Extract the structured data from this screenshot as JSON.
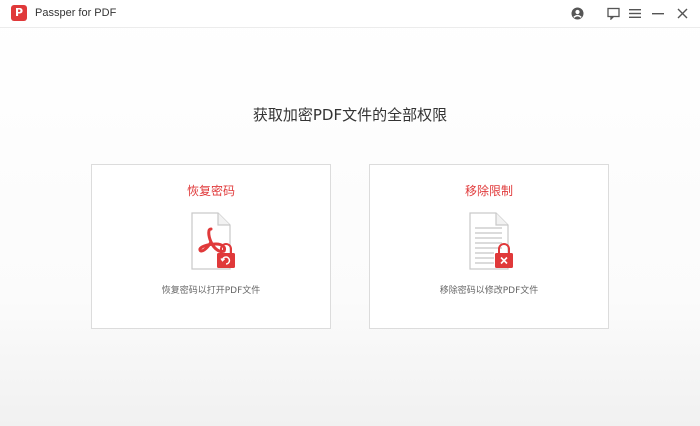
{
  "app": {
    "title": "Passper for PDF",
    "logo_letter": "P"
  },
  "titlebar": {
    "buttons": [
      "account-icon",
      "feedback-icon",
      "menu-icon",
      "minimize-icon",
      "close-icon"
    ]
  },
  "main": {
    "heading": "获取加密PDF文件的全部权限",
    "cards": [
      {
        "title": "恢复密码",
        "desc": "恢复密码以打开PDF文件",
        "icon": "pdf-unlock-icon"
      },
      {
        "title": "移除限制",
        "desc": "移除密码以修改PDF文件",
        "icon": "document-remove-lock-icon"
      }
    ]
  },
  "colors": {
    "accent": "#e0393a",
    "text": "#333333",
    "border": "#dcdcdc"
  }
}
